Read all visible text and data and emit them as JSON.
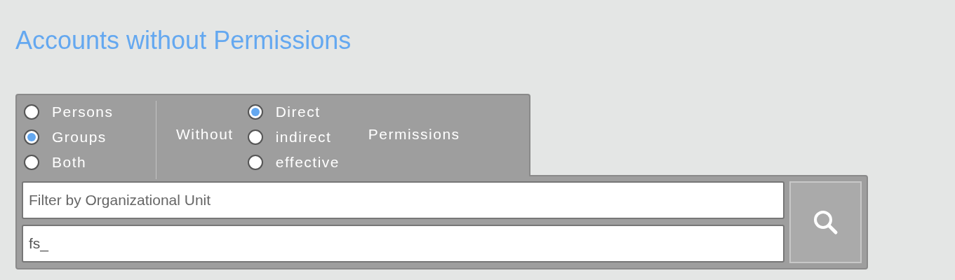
{
  "title": "Accounts without Permissions",
  "account_types": [
    {
      "label": "Persons",
      "selected": false
    },
    {
      "label": "Groups",
      "selected": true
    },
    {
      "label": "Both",
      "selected": false
    }
  ],
  "without_label": "Without",
  "permission_types": [
    {
      "label": "Direct",
      "selected": true
    },
    {
      "label": "indirect",
      "selected": false
    },
    {
      "label": "effective",
      "selected": false
    }
  ],
  "permissions_label": "Permissions",
  "filters": [
    {
      "placeholder": "Filter by Organizational Unit"
    },
    {
      "value": "fs_"
    }
  ]
}
